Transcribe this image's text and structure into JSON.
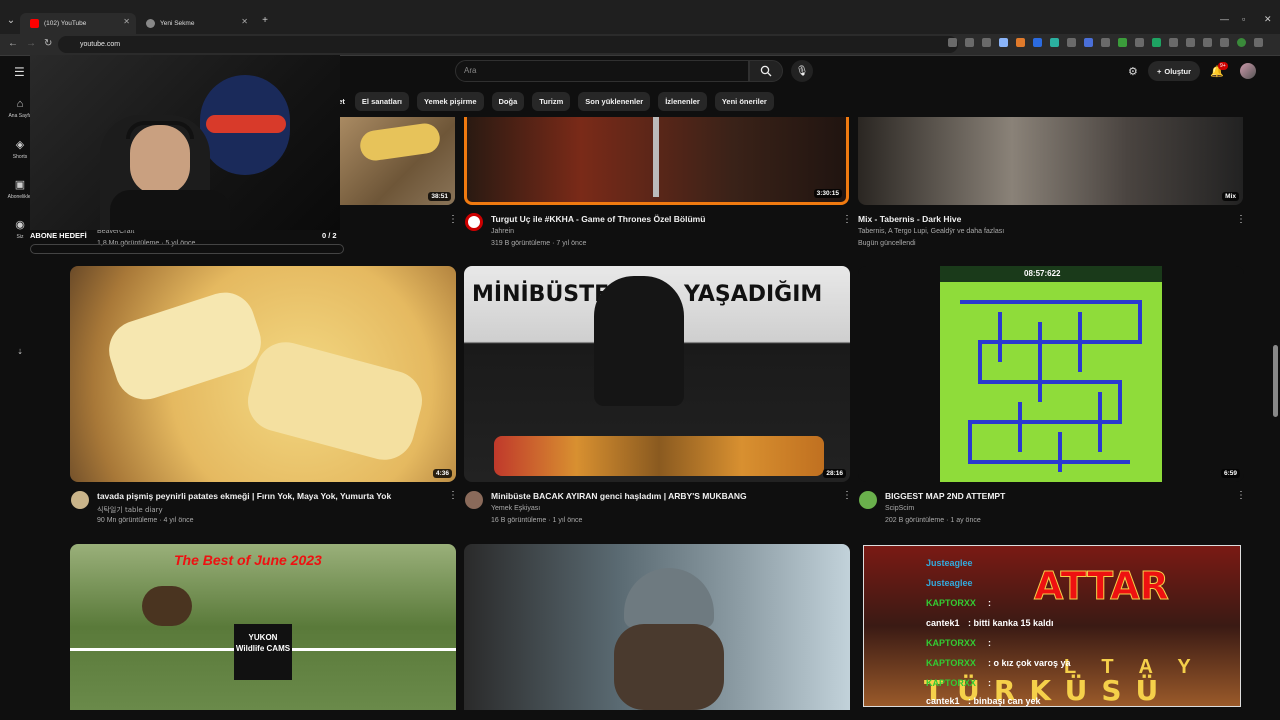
{
  "browser": {
    "tabs": [
      {
        "label": "(102) YouTube",
        "active": true
      },
      {
        "label": "Yeni Sekme",
        "active": false
      }
    ],
    "url": "youtube.com"
  },
  "header": {
    "search_placeholder": "Ara",
    "create_label": "Oluştur",
    "notif_count": "9+"
  },
  "chips": [
    "...et",
    "El sanatları",
    "Yemek pişirme",
    "Doğa",
    "Turizm",
    "Son yüklenenler",
    "İzlenenler",
    "Yeni öneriler"
  ],
  "sidebar": [
    {
      "label": "Ana Sayfa",
      "icon": "home-icon"
    },
    {
      "label": "Shorts",
      "icon": "shorts-icon"
    },
    {
      "label": "Abonelikler",
      "icon": "subscriptions-icon"
    },
    {
      "label": "Siz",
      "icon": "you-icon"
    }
  ],
  "overlay": {
    "goal_label": "ABONE HEDEFİ",
    "goal_count": "0 / 2"
  },
  "row1": [
    {
      "channel": "BeaverCraft",
      "meta": "1,8 Mn görüntüleme · 5 yıl önce",
      "duration": "38:51"
    },
    {
      "title": "Turgut Uç ile #KKHA - Game of Thrones Özel Bölümü",
      "channel": "Jahrein",
      "meta": "319 B görüntüleme · 7 yıl önce",
      "duration": "3:30:15"
    },
    {
      "title": "Mix - Tabernis - Dark Hive",
      "channel": "Tabernis, A Tergo Lupi, Gealdÿr ve daha fazlası",
      "meta": "Bugün güncellendi",
      "duration": "Mix"
    }
  ],
  "row2": [
    {
      "title": "tavada pişmiş peynirli patates ekmeği | Fırın Yok, Maya Yok, Yumurta Yok",
      "channel": "식탁일기 table diary",
      "meta": "90 Mn görüntüleme · 4 yıl önce",
      "duration": "4:36"
    },
    {
      "title": "Minibüste BACAK AYIRAN genci haşladım | ARBY'S MUKBANG",
      "channel": "Yemek Eşkiyası",
      "meta": "16 B görüntüleme · 1 yıl önce",
      "duration": "28:16",
      "thumb_text_left": "MİNİBÜSTE",
      "thumb_text_right": "YAŞADIĞIM"
    },
    {
      "title": "BIGGEST MAP 2ND ATTEMPT",
      "channel": "ScipScim",
      "meta": "202 B görüntüleme · 1 ay önce",
      "duration": "6:59",
      "timer": "08:57:622"
    }
  ],
  "row3": [
    {
      "thumb_title": "The Best of June 2023",
      "logo": "YUKON Wildlife CAMS"
    },
    {},
    {
      "attar": "ATTAR",
      "turku": "TÜRKÜSÜ",
      "ltay": "L T A Y"
    }
  ],
  "chat": [
    {
      "user": "Justeaglee",
      "text": ""
    },
    {
      "user": "Justeaglee",
      "text": ""
    },
    {
      "user": "KAPTORXX",
      "text": ":"
    },
    {
      "user": "cantek1",
      "text": ": bitti kanka 15 kaldı"
    },
    {
      "user": "KAPTORXX",
      "text": ":"
    },
    {
      "user": "KAPTORXX",
      "text": ": o kız çok varoş ya"
    },
    {
      "user": "KAPTORXX",
      "text": ":"
    },
    {
      "user": "cantek1",
      "text": ": binbaşı can yek"
    }
  ]
}
